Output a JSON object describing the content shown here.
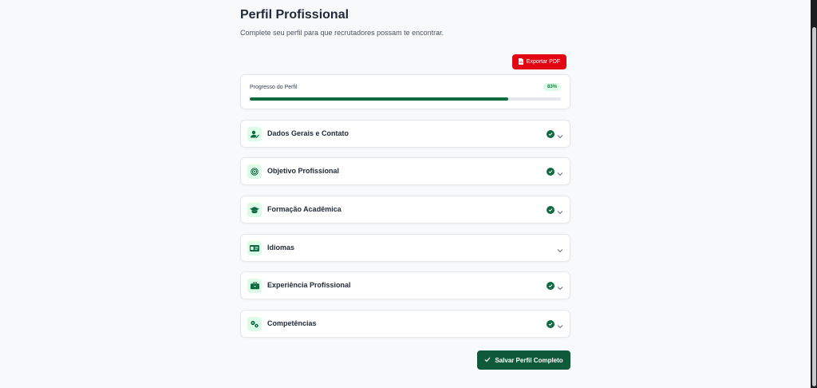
{
  "header": {
    "title": "Perfil Profissional",
    "subtitle": "Complete seu perfil para que recrutadores possam te encontrar."
  },
  "export": {
    "label": "Exportar PDF",
    "icon": "file-pdf-icon",
    "color": "#e30613"
  },
  "progress": {
    "label": "Progresso do Perfil",
    "percent_label": "83%",
    "value": 83
  },
  "sections": [
    {
      "title": "Dados Gerais e Contato",
      "icon": "user-edit-icon",
      "complete": true
    },
    {
      "title": "Objetivo Profissional",
      "icon": "target-icon",
      "complete": true
    },
    {
      "title": "Formação Acadêmica",
      "icon": "graduation-cap-icon",
      "complete": true
    },
    {
      "title": "Idiomas",
      "icon": "language-icon",
      "complete": false
    },
    {
      "title": "Experiência Profissional",
      "icon": "briefcase-icon",
      "complete": true
    },
    {
      "title": "Competências",
      "icon": "gears-icon",
      "complete": true
    }
  ],
  "save": {
    "label": "Salvar Perfil Completo",
    "icon": "check-icon",
    "color": "#0f5a3a"
  },
  "colors": {
    "accent": "#0f6b3f",
    "accent_light": "#dcfce7",
    "danger": "#e30613"
  }
}
